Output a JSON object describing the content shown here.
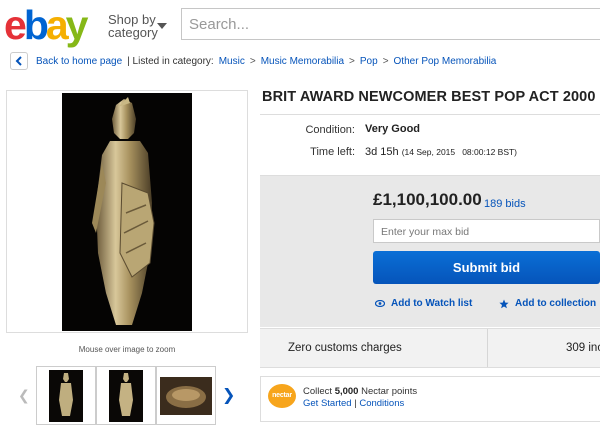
{
  "header": {
    "logo": "ebay",
    "logo_colors": [
      "#e53238",
      "#0064d2",
      "#f5af02",
      "#86b817"
    ],
    "shop_by_line1": "Shop by",
    "shop_by_line2": "category",
    "search_placeholder": "Search..."
  },
  "breadcrumb": {
    "back_label": "Back to home page",
    "listed_label": "| Listed in category:",
    "items": [
      "Music",
      "Music Memorabilia",
      "Pop",
      "Other Pop Memorabilia"
    ]
  },
  "gallery": {
    "zoom_hint": "Mouse over image to zoom"
  },
  "listing": {
    "title": "BRIT AWARD NEWCOMER BEST POP ACT 2000",
    "condition_label": "Condition:",
    "condition_value": "Very Good",
    "time_left_label": "Time left:",
    "time_left_value": "3d 15h",
    "time_left_end": "(14 Sep, 2015   08:00:12 BST)"
  },
  "bidding": {
    "price": "£1,100,100.00",
    "bids": "189 bids",
    "max_bid_placeholder": "Enter your max bid",
    "submit_label": "Submit bid",
    "watch_label": "Add to Watch list",
    "collection_label": "Add to collection",
    "accent": "#0654ba"
  },
  "info": {
    "customs": "Zero customs charges",
    "imports": "309 inc"
  },
  "nectar": {
    "logo": "nectar",
    "prefix": "Collect",
    "points": "5,000",
    "suffix": "Nectar points",
    "get_started": "Get Started",
    "separator": "|",
    "conditions": "Conditions"
  }
}
